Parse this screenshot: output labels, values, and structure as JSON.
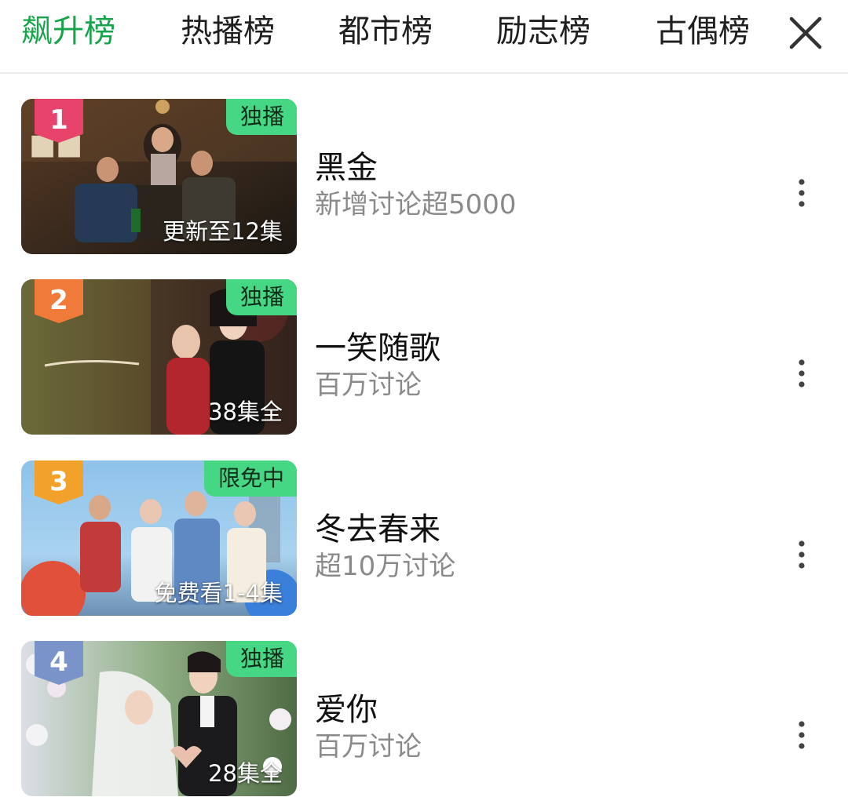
{
  "tabs": [
    {
      "label": "飙升榜",
      "active": true
    },
    {
      "label": "热播榜",
      "active": false
    },
    {
      "label": "都市榜",
      "active": false
    },
    {
      "label": "励志榜",
      "active": false
    },
    {
      "label": "古偶榜",
      "active": false
    }
  ],
  "close_icon": "close-icon",
  "items": [
    {
      "rank": "1",
      "badge": "独播",
      "overlay": "更新至12集",
      "title": "黑金",
      "subtitle": "新增讨论超5000",
      "rank_color": "#e8436a"
    },
    {
      "rank": "2",
      "badge": "独播",
      "overlay": "38集全",
      "title": "一笑随歌",
      "subtitle": "百万讨论",
      "rank_color": "#f07a3a"
    },
    {
      "rank": "3",
      "badge": "限免中",
      "overlay": "免费看1-4集",
      "title": "冬去春来",
      "subtitle": "超10万讨论",
      "rank_color": "#f2a12a"
    },
    {
      "rank": "4",
      "badge": "独播",
      "overlay": "28集全",
      "title": "爱你",
      "subtitle": "百万讨论",
      "rank_color": "#7a93c9"
    }
  ],
  "colors": {
    "accent": "#17a44a",
    "badge_bg": "#46d784"
  }
}
